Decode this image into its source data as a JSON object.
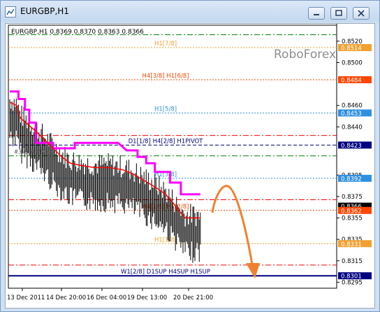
{
  "window": {
    "title": "EURGBP,H1",
    "icon": "chart-window-icon"
  },
  "controls": {
    "minimize": "minimize-icon",
    "maximize": "maximize-icon",
    "close": "close-icon"
  },
  "chart_header": "EURGBP,H1  0.8369 0.8370 0.8363 0.8366",
  "watermark": "RoboForex",
  "chart_data": {
    "type": "candlestick",
    "symbol": "EURGBP",
    "timeframe": "H1",
    "ohlc_header": {
      "open": 0.8369,
      "high": 0.837,
      "low": 0.8363,
      "close": 0.8366
    },
    "ylim": [
      0.8292,
      0.8531
    ],
    "y_ticks": [
      0.852,
      0.85,
      0.846,
      0.844,
      0.8395,
      0.8375,
      0.8355,
      0.8335,
      0.8315,
      0.8295
    ],
    "x_ticks": [
      "13 Dec 2011",
      "14 Dec 20:00",
      "16 Dec 04:00",
      "19 Dec 13:00",
      "20 Dec 21:00"
    ],
    "levels": [
      {
        "label": "",
        "price": 0.8526,
        "color": "#008000",
        "style": "dash-dot"
      },
      {
        "label": "H1[7/8]",
        "price": 0.8514,
        "color": "#f0a030",
        "style": "dotted"
      },
      {
        "label": "H4[3/8] H1[6/8]",
        "price": 0.8484,
        "color": "#ff4500",
        "style": "dotted"
      },
      {
        "label": "H1[5/8]",
        "price": 0.8453,
        "color": "#3090e0",
        "style": "dotted"
      },
      {
        "label": "",
        "price": 0.8432,
        "color": "#ff0000",
        "style": "dash-dot"
      },
      {
        "label": "D1[1/8] H4[2/8] H1PIVOT",
        "price": 0.8423,
        "color": "#000080",
        "style": "dash"
      },
      {
        "label": "",
        "price": 0.8413,
        "color": "#008000",
        "style": "dash-dot"
      },
      {
        "label": "H1[3/8]",
        "price": 0.8392,
        "color": "#3090e0",
        "style": "dotted"
      },
      {
        "label": "",
        "price": 0.8372,
        "color": "#ff0000",
        "style": "dash-dot"
      },
      {
        "label": "H4[1/8] H1[2/8]",
        "price": 0.8362,
        "color": "#ff4500",
        "style": "dotted"
      },
      {
        "label": "H1[1/8]",
        "price": 0.8331,
        "color": "#f0a030",
        "style": "dotted"
      },
      {
        "label": "",
        "price": 0.8311,
        "color": "#ff0000",
        "style": "dash-dot"
      },
      {
        "label": "W1[2/8] D1SUP H4SUP H1SUP",
        "price": 0.8301,
        "color": "#000080",
        "style": "solid"
      }
    ],
    "price_badges": [
      {
        "value": "0.8514",
        "color": "#f0a030"
      },
      {
        "value": "0.8484",
        "color": "#ff4500"
      },
      {
        "value": "0.8453",
        "color": "#3090e0"
      },
      {
        "value": "0.8423",
        "color": "#000080"
      },
      {
        "value": "0.8392",
        "color": "#3090e0"
      },
      {
        "value": "0.8366",
        "color": "#000000"
      },
      {
        "value": "0.8362",
        "color": "#ff4500"
      },
      {
        "value": "0.8331",
        "color": "#f0a030"
      },
      {
        "value": "0.8301",
        "color": "#000080"
      }
    ],
    "trade_marker": "#39969640 sell",
    "magenta_line": [
      [
        0,
        0.8473
      ],
      [
        8,
        0.8473
      ],
      [
        8,
        0.8466
      ],
      [
        14,
        0.8466
      ],
      [
        14,
        0.8456
      ],
      [
        18,
        0.8456
      ],
      [
        18,
        0.8444
      ],
      [
        24,
        0.8444
      ],
      [
        24,
        0.8425
      ],
      [
        40,
        0.8425
      ],
      [
        40,
        0.842
      ],
      [
        60,
        0.842
      ],
      [
        60,
        0.8425
      ],
      [
        80,
        0.8425
      ],
      [
        80,
        0.8425
      ],
      [
        100,
        0.8425
      ],
      [
        108,
        0.8418
      ],
      [
        118,
        0.8418
      ],
      [
        118,
        0.8412
      ],
      [
        126,
        0.8412
      ],
      [
        126,
        0.8406
      ],
      [
        134,
        0.8406
      ],
      [
        134,
        0.8398
      ],
      [
        148,
        0.8398
      ],
      [
        148,
        0.8388
      ],
      [
        158,
        0.8388
      ],
      [
        158,
        0.8377
      ],
      [
        176,
        0.8377
      ]
    ],
    "red_line": [
      [
        0,
        0.8463
      ],
      [
        6,
        0.846
      ],
      [
        10,
        0.8448
      ],
      [
        16,
        0.8443
      ],
      [
        24,
        0.8436
      ],
      [
        32,
        0.8428
      ],
      [
        40,
        0.842
      ],
      [
        48,
        0.8412
      ],
      [
        56,
        0.8406
      ],
      [
        66,
        0.8404
      ],
      [
        78,
        0.8402
      ],
      [
        92,
        0.8402
      ],
      [
        104,
        0.84
      ],
      [
        114,
        0.8396
      ],
      [
        124,
        0.839
      ],
      [
        134,
        0.8384
      ],
      [
        144,
        0.8377
      ],
      [
        150,
        0.837
      ],
      [
        156,
        0.8362
      ],
      [
        162,
        0.8355
      ],
      [
        166,
        0.8355
      ],
      [
        176,
        0.8355
      ]
    ],
    "forecast_arrow": "orange curved down arrow"
  }
}
